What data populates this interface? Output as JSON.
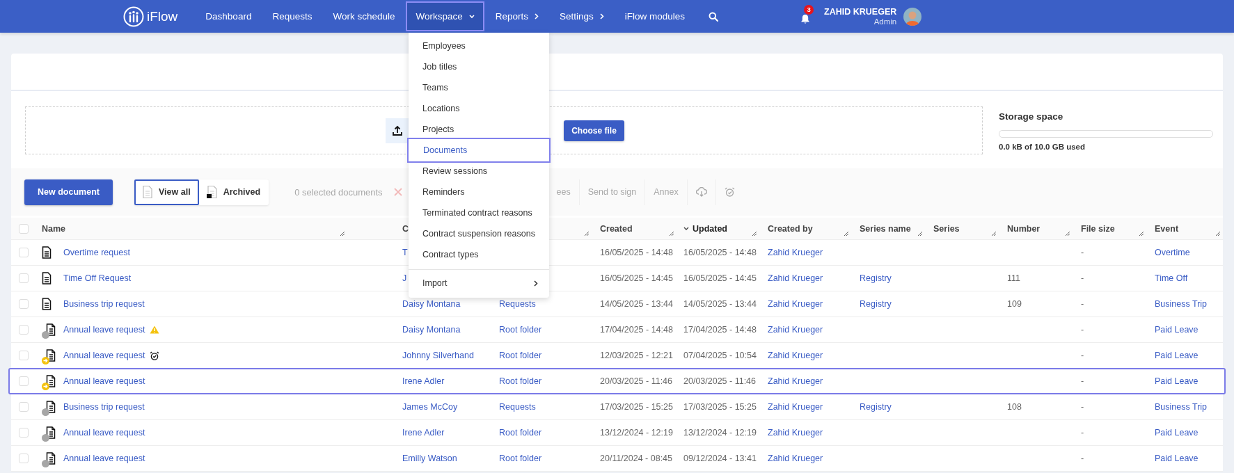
{
  "nav": {
    "logo": "iFlow",
    "items": [
      {
        "label": "Dashboard",
        "kind": "link",
        "highlighted": false
      },
      {
        "label": "Requests",
        "kind": "link",
        "highlighted": false
      },
      {
        "label": "Work schedule",
        "kind": "link",
        "highlighted": false
      },
      {
        "label": "Workspace",
        "kind": "dropdown",
        "highlighted": true
      },
      {
        "label": "Reports",
        "kind": "flyout",
        "highlighted": false
      },
      {
        "label": "Settings",
        "kind": "flyout",
        "highlighted": false
      },
      {
        "label": "iFlow modules",
        "kind": "link",
        "highlighted": false
      }
    ]
  },
  "user": {
    "notifications": "3",
    "name": "ZAHID KRUEGER",
    "role": "Admin"
  },
  "menu": {
    "items": [
      {
        "label": "Employees",
        "kind": "link",
        "highlighted": false
      },
      {
        "label": "Job titles",
        "kind": "link",
        "highlighted": false
      },
      {
        "label": "Teams",
        "kind": "link",
        "highlighted": false
      },
      {
        "label": "Locations",
        "kind": "link",
        "highlighted": false
      },
      {
        "label": "Projects",
        "kind": "link",
        "highlighted": false
      },
      {
        "label": "Documents",
        "kind": "link",
        "highlighted": true
      },
      {
        "label": "Review sessions",
        "kind": "link",
        "highlighted": false
      },
      {
        "label": "Reminders",
        "kind": "link",
        "highlighted": false
      },
      {
        "label": "Terminated contract reasons",
        "kind": "link",
        "highlighted": false
      },
      {
        "label": "Contract suspension reasons",
        "kind": "link",
        "highlighted": false
      },
      {
        "label": "Contract types",
        "kind": "link",
        "highlighted": false
      },
      {
        "label": "Import",
        "kind": "submenu",
        "highlighted": false
      }
    ]
  },
  "upload": {
    "button": "Choose file"
  },
  "storage": {
    "title": "Storage space",
    "level": 0,
    "usage": "0.0 kB of 10.0 GB used"
  },
  "toolbar": {
    "new_button": "New document",
    "views": [
      {
        "label": "View all",
        "selected": true
      },
      {
        "label": "Archived",
        "selected": false
      }
    ],
    "selection": "0 selected documents",
    "actions": [
      {
        "kind": "delete",
        "disabled": true
      },
      {
        "kind": "text",
        "label": "ees",
        "disabled": true
      },
      {
        "kind": "text",
        "label": "Send to sign",
        "disabled": true
      },
      {
        "kind": "text",
        "label": "Annex",
        "disabled": true
      },
      {
        "kind": "download",
        "disabled": true
      },
      {
        "kind": "reminder",
        "disabled": true
      }
    ]
  },
  "table": {
    "all_checked": false,
    "columns": {
      "name": {
        "label": "Name",
        "sorted": false
      },
      "owner": {
        "label": "C",
        "sorted": false
      },
      "created": {
        "label": "Created",
        "sorted": false
      },
      "updated": {
        "label": "Updated",
        "sorted": true
      },
      "created_by": {
        "label": "Created by",
        "sorted": false
      },
      "series_name": {
        "label": "Series name",
        "sorted": false
      },
      "series": {
        "label": "Series",
        "sorted": false
      },
      "number": {
        "label": "Number",
        "sorted": false
      },
      "file_size": {
        "label": "File size",
        "sorted": false
      },
      "event": {
        "label": "Event",
        "sorted": false
      }
    },
    "rows": [
      {
        "checked": false,
        "highlighted": false,
        "kind": "plain",
        "name": "Overtime request",
        "owner": "T",
        "created": "16/05/2025 - 14:48",
        "updated": "16/05/2025 - 14:48",
        "created_by": "Zahid Krueger",
        "file_size": "-",
        "event": "Overtime"
      },
      {
        "checked": false,
        "highlighted": false,
        "kind": "plain",
        "name": "Time Off Request",
        "owner": "J",
        "created": "16/05/2025 - 14:45",
        "updated": "16/05/2025 - 14:45",
        "created_by": "Zahid Krueger",
        "series_name": "Registry",
        "number": "111",
        "file_size": "-",
        "event": "Time Off"
      },
      {
        "checked": false,
        "highlighted": false,
        "kind": "plain",
        "name": "Business trip request",
        "owner": "Daisy Montana",
        "folder": "Requests",
        "created": "14/05/2025 - 13:44",
        "updated": "14/05/2025 - 13:44",
        "created_by": "Zahid Krueger",
        "series_name": "Registry",
        "number": "109",
        "file_size": "-",
        "event": "Business Trip"
      },
      {
        "checked": false,
        "highlighted": false,
        "kind": "idle",
        "warning": true,
        "name": "Annual leave request",
        "owner": "Daisy Montana",
        "folder": "Root folder",
        "created": "17/04/2025 - 14:48",
        "updated": "17/04/2025 - 14:48",
        "created_by": "Zahid Krueger",
        "file_size": "-",
        "event": "Paid Leave"
      },
      {
        "checked": false,
        "highlighted": false,
        "kind": "pending",
        "reminder": true,
        "name": "Annual leave request",
        "owner": "Johnny Silverhand",
        "folder": "Root folder",
        "created": "12/03/2025 - 12:21",
        "updated": "07/04/2025 - 10:54",
        "created_by": "Zahid Krueger",
        "file_size": "-",
        "event": "Paid Leave"
      },
      {
        "checked": false,
        "highlighted": true,
        "kind": "pending",
        "name": "Annual leave request",
        "owner": "Irene Adler",
        "folder": "Root folder",
        "created": "20/03/2025 - 11:46",
        "updated": "20/03/2025 - 11:46",
        "created_by": "Zahid Krueger",
        "file_size": "-",
        "event": "Paid Leave"
      },
      {
        "checked": false,
        "highlighted": false,
        "kind": "idle",
        "name": "Business trip request",
        "owner": "James McCoy",
        "folder": "Requests",
        "created": "17/03/2025 - 15:25",
        "updated": "17/03/2025 - 15:25",
        "created_by": "Zahid Krueger",
        "series_name": "Registry",
        "number": "108",
        "file_size": "-",
        "event": "Business Trip"
      },
      {
        "checked": false,
        "highlighted": false,
        "kind": "idle",
        "name": "Annual leave request",
        "owner": "Irene Adler",
        "folder": "Root folder",
        "created": "13/12/2024 - 12:19",
        "updated": "13/12/2024 - 12:19",
        "created_by": "Zahid Krueger",
        "file_size": "-",
        "event": "Paid Leave"
      },
      {
        "checked": false,
        "highlighted": false,
        "kind": "idle",
        "name": "Annual leave request",
        "owner": "Emilly Watson",
        "folder": "Root folder",
        "created": "20/11/2024 - 08:45",
        "updated": "09/12/2024 - 13:41",
        "created_by": "Zahid Krueger",
        "file_size": "-",
        "event": "Paid Leave"
      }
    ]
  }
}
